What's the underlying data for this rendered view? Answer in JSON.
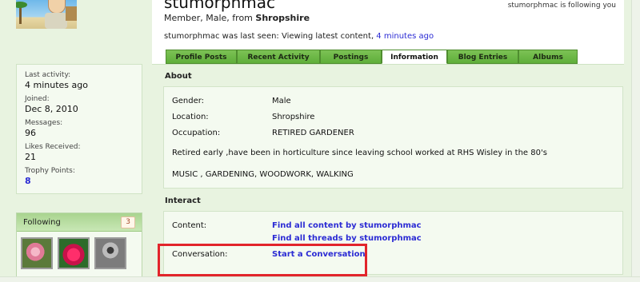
{
  "profile": {
    "username": "stumorphmac",
    "meta_prefix": "Member, Male, from ",
    "location_bold": "Shropshire",
    "last_seen_prefix": "stumorphmac was last seen: ",
    "last_seen_activity": "Viewing latest content",
    "last_seen_sep": ", ",
    "last_seen_time": "4 minutes ago",
    "following_you": "stumorphmac is following you"
  },
  "tabs": [
    {
      "label": "Profile Posts"
    },
    {
      "label": "Recent Activity"
    },
    {
      "label": "Postings"
    },
    {
      "label": "Information",
      "active": true
    },
    {
      "label": "Blog Entries"
    },
    {
      "label": "Albums"
    }
  ],
  "stats": {
    "last_activity_label": "Last activity:",
    "last_activity_value": "4 minutes ago",
    "joined_label": "Joined:",
    "joined_value": "Dec 8, 2010",
    "messages_label": "Messages:",
    "messages_value": "96",
    "likes_label": "Likes Received:",
    "likes_value": "21",
    "trophy_label": "Trophy Points:",
    "trophy_value": "8"
  },
  "following": {
    "title": "Following",
    "count": "3"
  },
  "about": {
    "title": "About",
    "gender_label": "Gender:",
    "gender_value": "Male",
    "location_label": "Location:",
    "location_value": "Shropshire",
    "occupation_label": "Occupation:",
    "occupation_value": "RETIRED GARDENER",
    "bio": "Retired early ,have been in horticulture since leaving school worked at RHS Wisley in the 80's",
    "interests": "MUSIC , GARDENING, WOODWORK, WALKING"
  },
  "interact": {
    "title": "Interact",
    "content_label": "Content:",
    "find_content": "Find all content by stumorphmac",
    "find_threads": "Find all threads by stumorphmac",
    "conversation_label": "Conversation:",
    "start_conversation": "Start a Conversation"
  },
  "colors": {
    "highlight": "#e2242b",
    "link": "#2b2bd4",
    "tab_green": "#5fae3a"
  }
}
